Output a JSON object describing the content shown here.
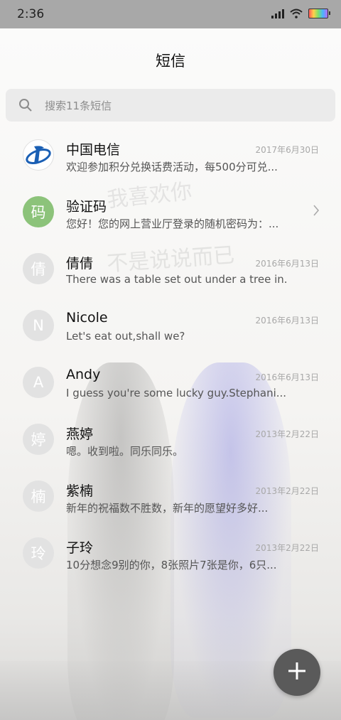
{
  "status_bar": {
    "time": "2:36"
  },
  "header": {
    "title": "短信"
  },
  "search": {
    "placeholder": "搜索11条短信"
  },
  "conversations": [
    {
      "avatar": "",
      "avatar_type": "telecom-logo",
      "name": "中国电信",
      "date": "2017年6月30日",
      "preview": "欢迎参加积分兑换话费活动，每500分可兑..."
    },
    {
      "avatar": "码",
      "avatar_type": "green",
      "name": "验证码",
      "date": "",
      "preview": "您好！您的网上营业厅登录的随机密码为：..."
    },
    {
      "avatar": "倩",
      "avatar_type": "gray",
      "name": "倩倩",
      "date": "2016年6月13日",
      "preview": "There was a table set out under a tree in..."
    },
    {
      "avatar": "N",
      "avatar_type": "gray",
      "name": "Nicole",
      "date": "2016年6月13日",
      "preview": "Let's eat out,shall we?"
    },
    {
      "avatar": "A",
      "avatar_type": "gray",
      "name": "Andy",
      "date": "2016年6月13日",
      "preview": "I guess you're some lucky guy.Stephani..."
    },
    {
      "avatar": "婷",
      "avatar_type": "gray",
      "name": "燕婷",
      "date": "2013年2月22日",
      "preview": "嗯。收到啦。同乐同乐。"
    },
    {
      "avatar": "楠",
      "avatar_type": "gray",
      "name": "紫楠",
      "date": "2013年2月22日",
      "preview": "新年的祝福数不胜数，新年的愿望好多好..."
    },
    {
      "avatar": "玲",
      "avatar_type": "gray",
      "name": "子玲",
      "date": "2013年2月22日",
      "preview": "10分想念9别的你，8张照片7张是你，6只..."
    }
  ],
  "wallpaper": {
    "text_line_1": "我喜欢你",
    "text_line_2": "不是说说而已"
  },
  "icons": {
    "search": "search-icon",
    "chevron": "chevron-right-icon",
    "fab": "plus-icon"
  },
  "colors": {
    "fab": "#5a5a5a",
    "verify_avatar": "#8cc37a",
    "status_bar": "#a8a8a8"
  }
}
